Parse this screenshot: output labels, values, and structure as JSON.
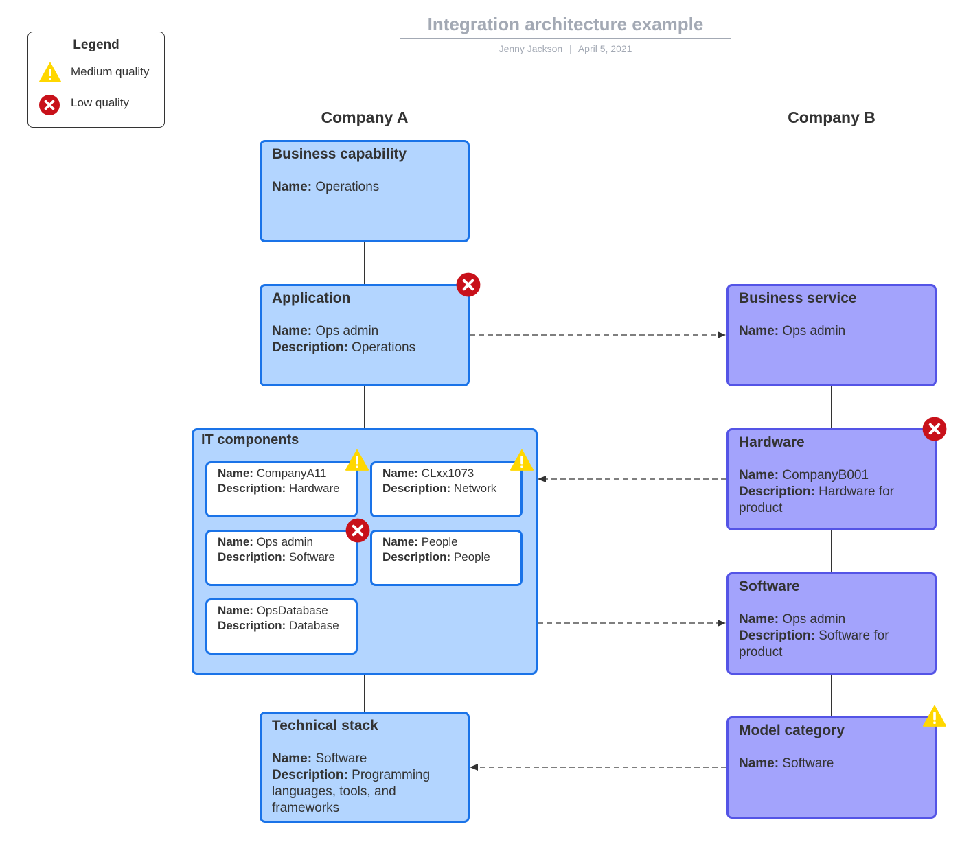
{
  "header": {
    "title": "Integration architecture example",
    "author": "Jenny Jackson",
    "separator": "|",
    "date": "April 5, 2021"
  },
  "legend": {
    "title": "Legend",
    "items": [
      {
        "icon": "warning-triangle-icon",
        "label": "Medium quality",
        "color": "#ffd700"
      },
      {
        "icon": "error-x-circle-icon",
        "label": "Low quality",
        "color": "#c8111a"
      }
    ]
  },
  "colors": {
    "company_a_fill": "#b3d5ff",
    "company_a_border": "#1a73e8",
    "company_b_fill": "#a3a3fc",
    "company_b_border": "#5454e6",
    "medium_quality": "#ffd700",
    "low_quality": "#c8111a"
  },
  "columns": {
    "company_a": "Company A",
    "company_b": "Company B"
  },
  "company_a": {
    "business_capability": {
      "title": "Business capability",
      "fields": [
        {
          "label": "Name:",
          "value": "Operations"
        }
      ]
    },
    "application": {
      "title": "Application",
      "quality": "low",
      "fields": [
        {
          "label": "Name:",
          "value": "Ops admin"
        },
        {
          "label": "Description:",
          "value": "Operations"
        }
      ]
    },
    "it_components": {
      "title": "IT components",
      "items": [
        {
          "name_label": "Name:",
          "name": "CompanyA11",
          "desc_label": "Description:",
          "desc": "Hardware",
          "quality": "medium"
        },
        {
          "name_label": "Name:",
          "name": "CLxx1073",
          "desc_label": "Description:",
          "desc": "Network",
          "quality": "medium"
        },
        {
          "name_label": "Name:",
          "name": "Ops admin",
          "desc_label": "Description:",
          "desc": "Software",
          "quality": "low"
        },
        {
          "name_label": "Name:",
          "name": "People",
          "desc_label": "Description:",
          "desc": "People",
          "quality": ""
        },
        {
          "name_label": "Name:",
          "name": "OpsDatabase",
          "desc_label": "Description:",
          "desc": "Database",
          "quality": ""
        }
      ]
    },
    "technical_stack": {
      "title": "Technical stack",
      "fields": [
        {
          "label": "Name:",
          "value": "Software"
        },
        {
          "label": "Description:",
          "value": "Programming languages, tools, and frameworks"
        }
      ]
    }
  },
  "company_b": {
    "business_service": {
      "title": "Business service",
      "fields": [
        {
          "label": "Name:",
          "value": "Ops admin"
        }
      ]
    },
    "hardware": {
      "title": "Hardware",
      "quality": "low",
      "fields": [
        {
          "label": "Name:",
          "value": "CompanyB001"
        },
        {
          "label": "Description:",
          "value": "Hardware for product"
        }
      ]
    },
    "software": {
      "title": "Software",
      "fields": [
        {
          "label": "Name:",
          "value": "Ops admin"
        },
        {
          "label": "Description:",
          "value": "Software for product"
        }
      ]
    },
    "model_category": {
      "title": "Model category",
      "quality": "medium",
      "fields": [
        {
          "label": "Name:",
          "value": "Software"
        }
      ]
    }
  },
  "connections": [
    {
      "from": "Business capability",
      "to": "Application",
      "style": "solid"
    },
    {
      "from": "Application",
      "to": "IT components",
      "style": "solid"
    },
    {
      "from": "IT components",
      "to": "Technical stack",
      "style": "solid"
    },
    {
      "from": "Business service",
      "to": "Hardware",
      "style": "solid"
    },
    {
      "from": "Hardware",
      "to": "Software",
      "style": "solid"
    },
    {
      "from": "Software",
      "to": "Model category",
      "style": "solid"
    },
    {
      "from": "Application",
      "to": "Business service",
      "style": "dashed-arrow"
    },
    {
      "from": "Hardware",
      "to": "IT components",
      "style": "dashed-arrow"
    },
    {
      "from": "IT components",
      "to": "Software",
      "style": "dashed-arrow"
    },
    {
      "from": "Model category",
      "to": "Technical stack",
      "style": "dashed-arrow"
    }
  ]
}
